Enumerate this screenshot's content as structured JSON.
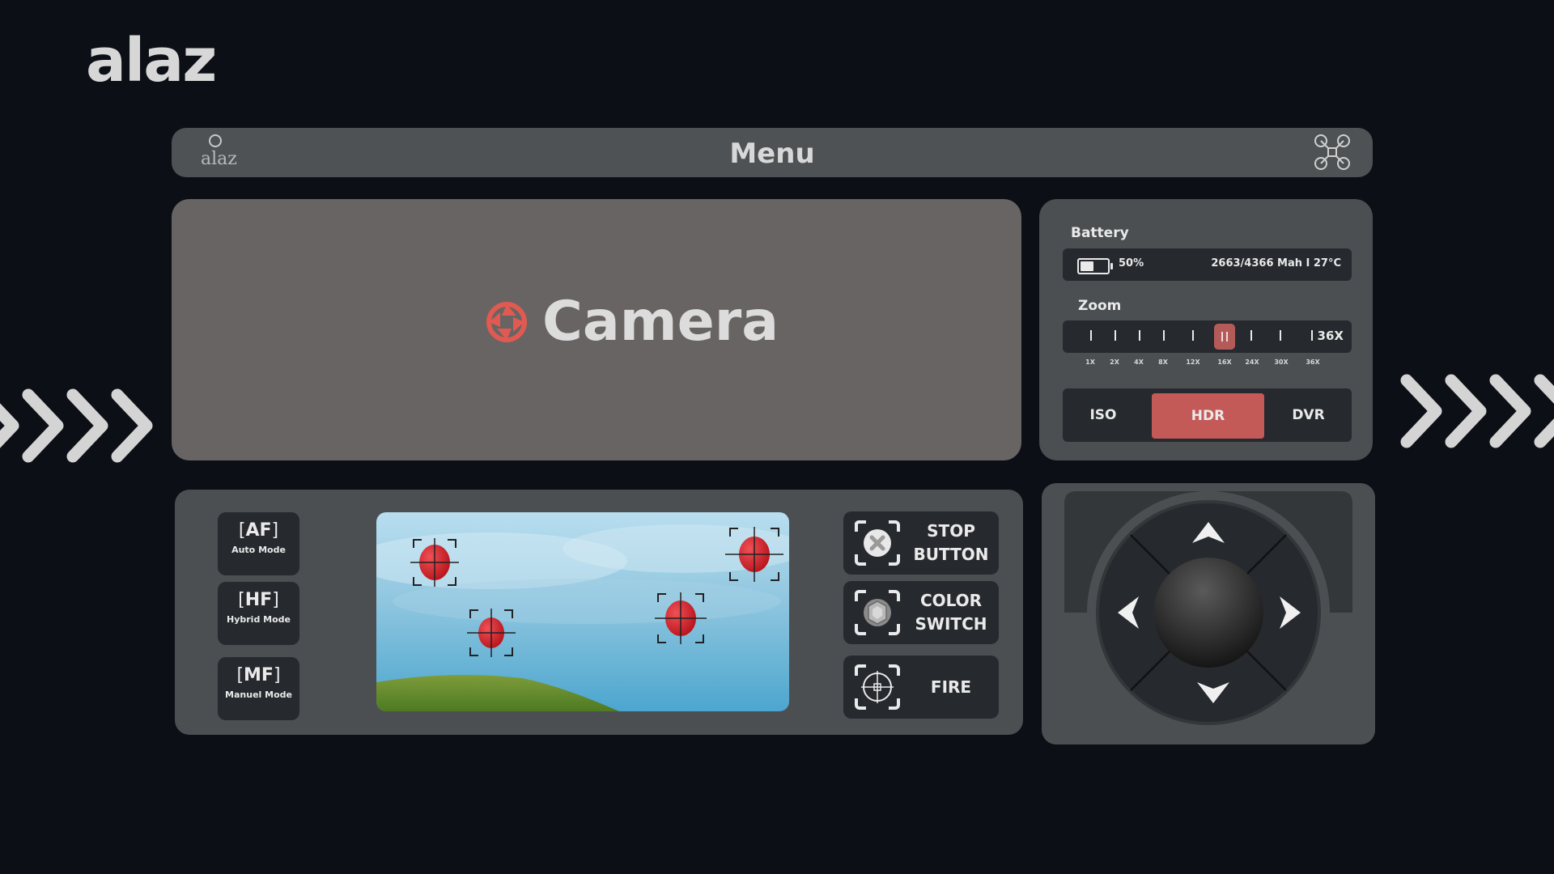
{
  "brand": {
    "name": "alaz"
  },
  "menu_bar": {
    "title": "Menu",
    "logo_text": "alaz",
    "logo_icon": "alaz-logo-icon",
    "drone_icon": "drone-icon"
  },
  "camera": {
    "label": "Camera",
    "icon": "aperture-icon",
    "accent": "#e05a52"
  },
  "battery": {
    "label": "Battery",
    "percent_text": "50%",
    "level": 0.5,
    "info": "2663/4366 Mah  I  27°C"
  },
  "zoom": {
    "label": "Zoom",
    "max_label": "36X",
    "levels": [
      "1X",
      "2X",
      "4X",
      "8X",
      "12X",
      "16X",
      "24X",
      "30X",
      "36X"
    ],
    "selected": "16X"
  },
  "image_modes": {
    "options": [
      "ISO",
      "HDR",
      "DVR"
    ],
    "selected": "HDR",
    "accent": "#c45a58"
  },
  "focus_modes": [
    {
      "code": "AF",
      "label": "Auto Mode"
    },
    {
      "code": "HF",
      "label": "Hybrid Mode"
    },
    {
      "code": "MF",
      "label": "Manuel Mode"
    }
  ],
  "actions": [
    {
      "line1": "STOP",
      "line2": "BUTTON",
      "icon": "stop-x-icon"
    },
    {
      "line1": "COLOR",
      "line2": "SWITCH",
      "icon": "color-switch-icon"
    },
    {
      "line1": "FIRE",
      "line2": "",
      "icon": "crosshair-icon"
    }
  ],
  "dpad": {
    "icons": [
      "arrow-up-icon",
      "arrow-left-icon",
      "arrow-right-icon",
      "arrow-down-icon"
    ]
  },
  "colors": {
    "background": "#0c0f16",
    "panel": "#4b4f52",
    "dark": "#26292d",
    "balloon": "#d7262e"
  }
}
